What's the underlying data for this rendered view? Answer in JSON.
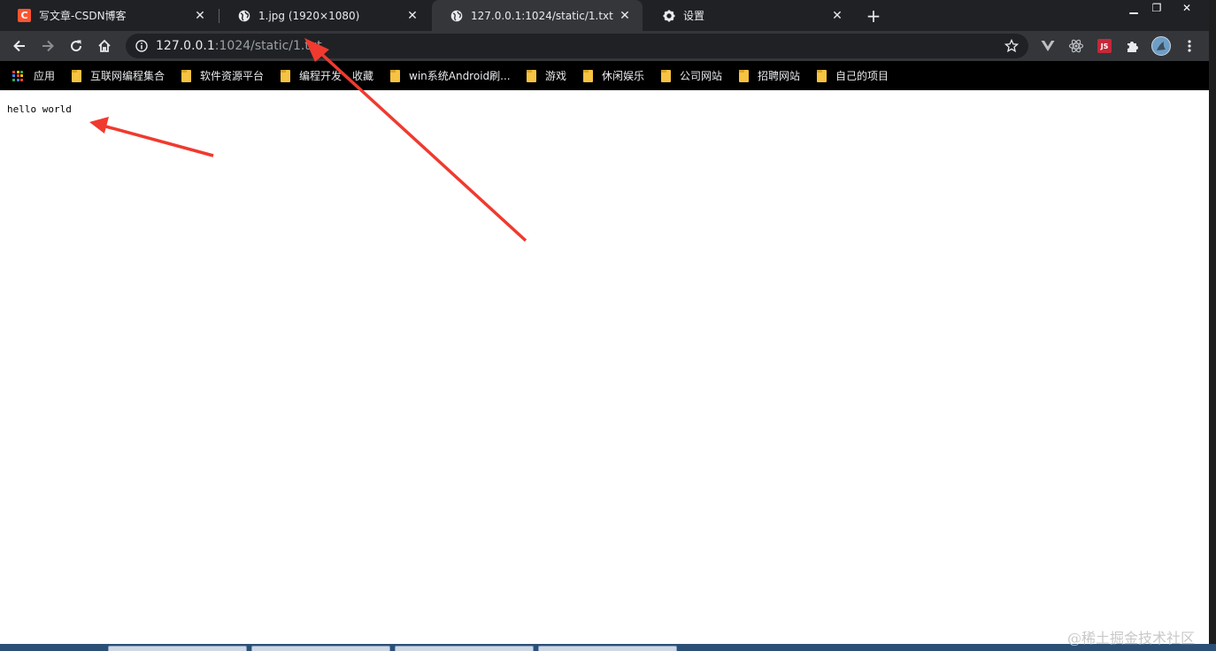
{
  "tabs": [
    {
      "title": "写文章-CSDN博客",
      "favicon": "csdn-icon",
      "favicon_text": "C",
      "active": false
    },
    {
      "title": "1.jpg (1920×1080)",
      "favicon": "globe-icon",
      "active": false
    },
    {
      "title": "127.0.0.1:1024/static/1.txt",
      "favicon": "globe-icon",
      "active": true
    },
    {
      "title": "设置",
      "favicon": "gear-icon",
      "active": false
    }
  ],
  "address_bar": {
    "host": "127.0.0.1",
    "path": ":1024/static/1.txt"
  },
  "bookmarks": [
    {
      "label": "应用",
      "icon": "apps-grid-icon"
    },
    {
      "label": "互联网编程集合",
      "icon": "folder-icon"
    },
    {
      "label": "软件资源平台",
      "icon": "folder-icon"
    },
    {
      "label": "编程开发",
      "icon": "folder-icon"
    },
    {
      "label": "收藏",
      "icon": "none"
    },
    {
      "label": "win系统Android刷...",
      "icon": "folder-icon"
    },
    {
      "label": "游戏",
      "icon": "folder-icon"
    },
    {
      "label": "休闲娱乐",
      "icon": "folder-icon"
    },
    {
      "label": "公司网站",
      "icon": "folder-icon"
    },
    {
      "label": "招聘网站",
      "icon": "folder-icon"
    },
    {
      "label": "自己的项目",
      "icon": "folder-icon"
    }
  ],
  "page_content": {
    "text": "hello world"
  },
  "extensions": {
    "js_badge": "JS"
  },
  "watermark": "@稀土掘金技术社区",
  "colors": {
    "tabstrip": "#202124",
    "toolbar": "#35363a",
    "bookmarks_bar": "#000000",
    "annotation_arrow": "#f03a2f",
    "folder": "#f6c342"
  }
}
